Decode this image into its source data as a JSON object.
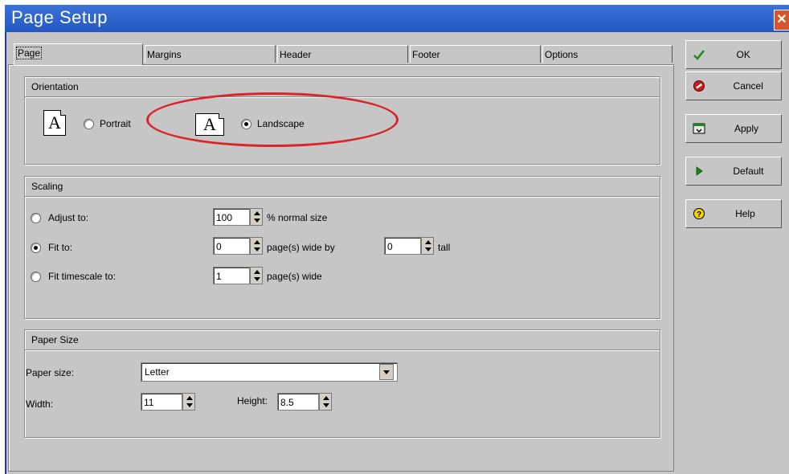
{
  "window": {
    "title": "Page Setup",
    "close_glyph": "✕"
  },
  "tabs": [
    {
      "label": "Page"
    },
    {
      "label": "Margins"
    },
    {
      "label": "Header"
    },
    {
      "label": "Footer"
    },
    {
      "label": "Options"
    }
  ],
  "orientation": {
    "heading": "Orientation",
    "portrait_label": "Portrait",
    "landscape_label": "Landscape",
    "icon_glyph": "A",
    "selected": "landscape"
  },
  "scaling": {
    "heading": "Scaling",
    "adjust_to_label": "Adjust to:",
    "adjust_to_value": "100",
    "adjust_to_suffix": "% normal size",
    "fit_to_label": "Fit to:",
    "fit_to_wide_value": "0",
    "fit_to_wide_suffix": "page(s) wide by",
    "fit_to_tall_value": "0",
    "fit_to_tall_suffix": "tall",
    "fit_timescale_label": "Fit timescale to:",
    "fit_timescale_value": "1",
    "fit_timescale_suffix": "page(s) wide",
    "selected": "fit_to"
  },
  "paper": {
    "heading": "Paper Size",
    "size_label": "Paper size:",
    "size_value": "Letter",
    "width_label": "Width:",
    "width_value": "11",
    "height_label": "Height:",
    "height_value": "8.5"
  },
  "buttons": {
    "ok": "OK",
    "cancel": "Cancel",
    "apply": "Apply",
    "default": "Default",
    "help": "Help"
  },
  "colors": {
    "title_bar": "#2457c4",
    "dialog_bg": "#c6c6c6",
    "highlight_oval": "#d9252a"
  }
}
